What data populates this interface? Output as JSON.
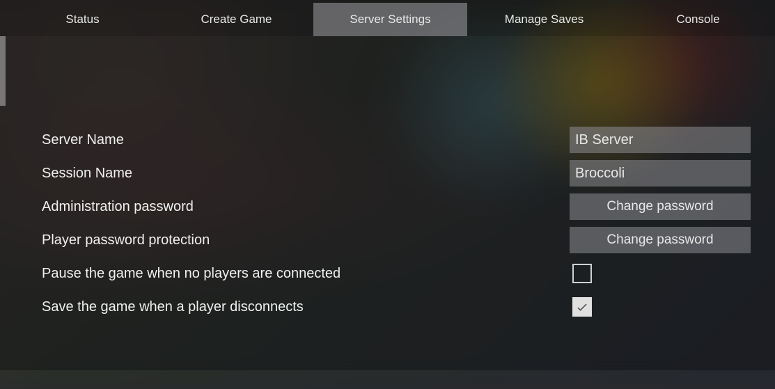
{
  "tabs": {
    "status": "Status",
    "create_game": "Create Game",
    "server_settings": "Server Settings",
    "manage_saves": "Manage Saves",
    "console": "Console"
  },
  "active_tab": "server_settings",
  "settings": {
    "server_name": {
      "label": "Server Name",
      "value": "IB Server"
    },
    "session_name": {
      "label": "Session Name",
      "value": "Broccoli"
    },
    "admin_password": {
      "label": "Administration password",
      "button": "Change password"
    },
    "player_password": {
      "label": "Player password protection",
      "button": "Change password"
    },
    "pause_no_players": {
      "label": "Pause the game when no players are connected",
      "checked": false
    },
    "save_on_disconnect": {
      "label": "Save the game when a player disconnects",
      "checked": true
    }
  }
}
